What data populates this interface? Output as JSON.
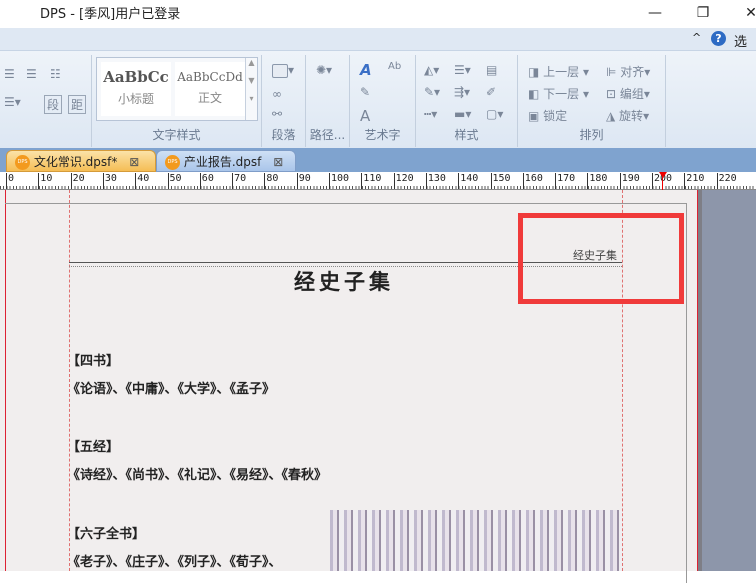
{
  "window": {
    "title": "DPS - [季风]用户已登录",
    "minimize": "—",
    "restore": "❐",
    "close": "✕"
  },
  "ribbon_bar": {
    "collapse": "^",
    "help": "?",
    "options": "选项"
  },
  "ribbon": {
    "para_btns": [
      "段",
      "距"
    ],
    "styles": [
      {
        "sample": "AaBbCc",
        "name": "小标题"
      },
      {
        "sample": "AaBbCcDd",
        "name": "正文"
      }
    ],
    "groups": [
      "文字样式",
      "段落",
      "路径...",
      "艺术字",
      "样式",
      "排列"
    ],
    "arrange": {
      "bring_forward": "上一层",
      "send_backward": "下一层",
      "lock": "锁定",
      "align": "对齐",
      "group": "编组",
      "rotate": "旋转"
    }
  },
  "doc_tabs": [
    {
      "label": "文化常识.dpsf*",
      "active": true
    },
    {
      "label": "产业报告.dpsf",
      "active": false
    }
  ],
  "ruler": [
    "0",
    "10",
    "20",
    "30",
    "40",
    "50",
    "60",
    "70",
    "80",
    "90",
    "100",
    "110",
    "120",
    "130",
    "140",
    "150",
    "160",
    "170",
    "180",
    "190",
    "200",
    "210",
    "220"
  ],
  "page": {
    "header": "经史子集",
    "title": "经史子集",
    "sections": [
      {
        "heading": "【四书】",
        "body": "《论语》、《中庸》、《大学》、《孟子》"
      },
      {
        "heading": "【五经】",
        "body": "《诗经》、《尚书》、《礼记》、《易经》、《春秋》"
      },
      {
        "heading": "【六子全书】",
        "body": "《老子》、《庄子》、《列子》、《荀子》、"
      }
    ]
  },
  "colors": {
    "highlight": "#f03a3a",
    "tabstrip": "#7fa3cf",
    "active_tab": "#f7c76a"
  }
}
